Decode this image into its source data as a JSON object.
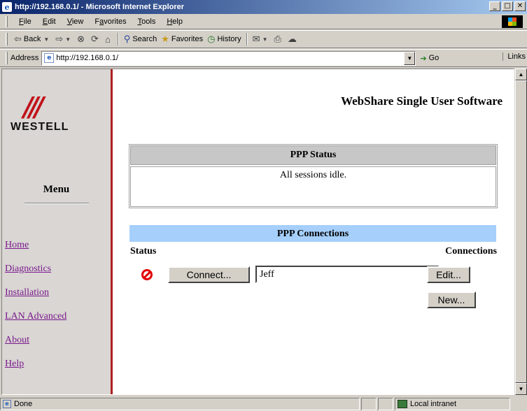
{
  "window": {
    "title": "http://192.168.0.1/ - Microsoft Internet Explorer"
  },
  "menubar": {
    "items": [
      {
        "ul": "F",
        "rest": "ile"
      },
      {
        "ul": "E",
        "rest": "dit"
      },
      {
        "ul": "V",
        "rest": "iew"
      },
      {
        "pre": "F",
        "ul": "a",
        "rest": "vorites"
      },
      {
        "ul": "T",
        "rest": "ools"
      },
      {
        "ul": "H",
        "rest": "elp"
      }
    ]
  },
  "toolbar": {
    "back": "Back",
    "search": "Search",
    "favorites": "Favorites",
    "history": "History"
  },
  "addressbar": {
    "label": "Address",
    "url": "http://192.168.0.1/",
    "go": "Go",
    "links": "Links"
  },
  "sidebar": {
    "logo_text": "WESTELL",
    "menu_heading": "Menu",
    "nav": [
      "Home",
      "Diagnostics",
      "Installation",
      "LAN Advanced",
      "About",
      "Help"
    ]
  },
  "main": {
    "title": "WebShare Single User Software",
    "ppp_status": {
      "heading": "PPP Status",
      "message": "All sessions idle."
    },
    "ppp_connections": {
      "heading": "PPP Connections",
      "status_col": "Status",
      "connections_col": "Connections",
      "connect_button": "Connect...",
      "connection_name": "Jeff",
      "edit_button": "Edit...",
      "new_button": "New..."
    }
  },
  "statusbar": {
    "text": "Done",
    "zone": "Local intranet"
  }
}
